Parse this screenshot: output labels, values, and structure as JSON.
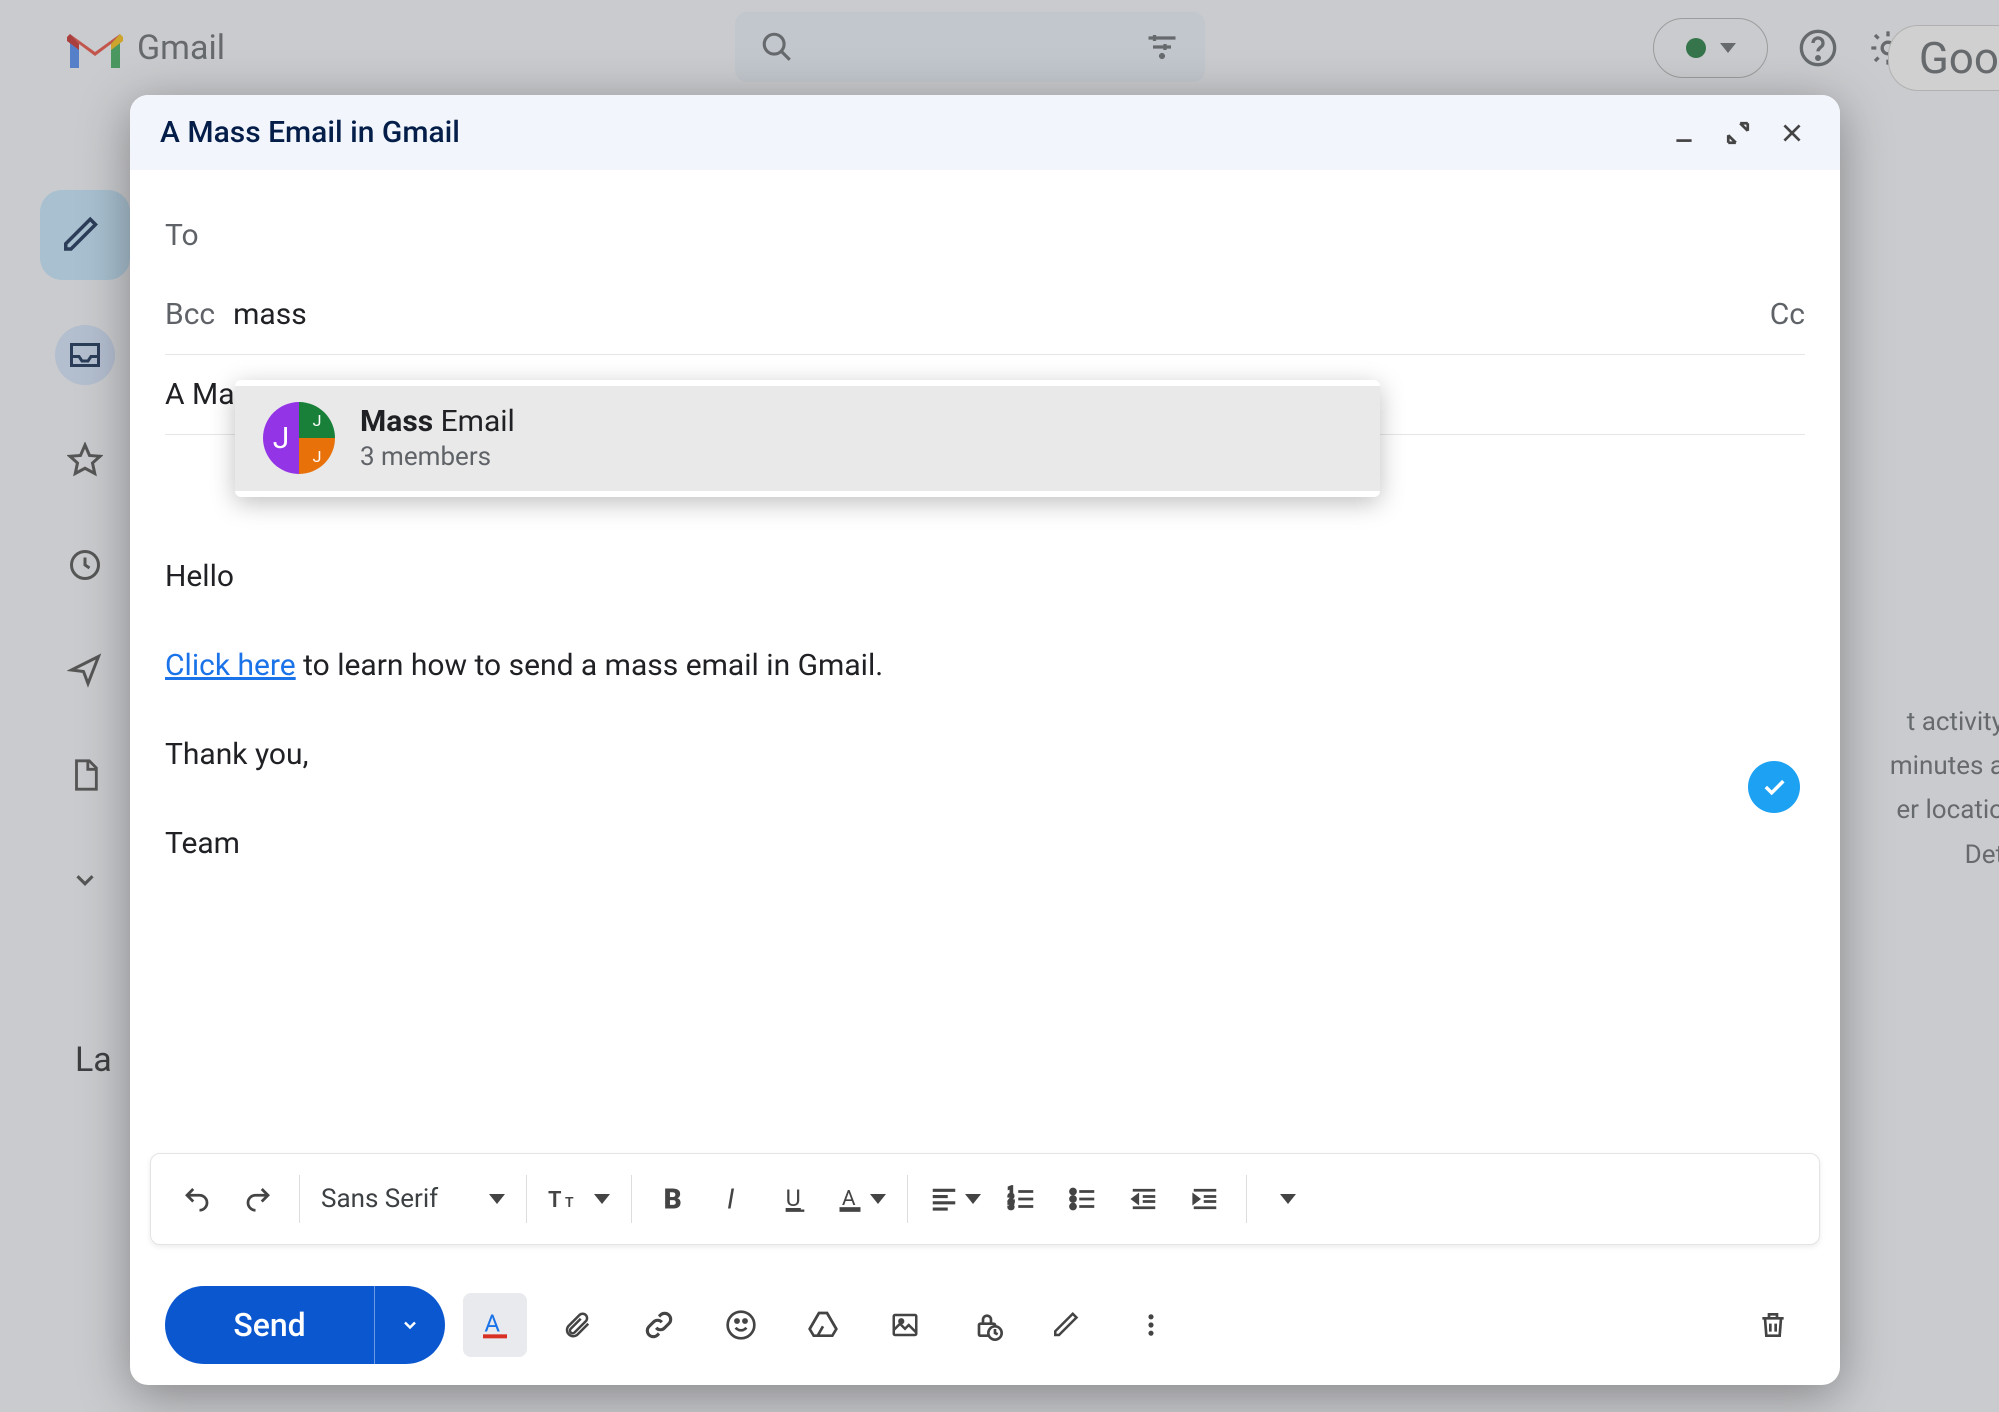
{
  "app": {
    "name": "Gmail",
    "google_partial": "Goo"
  },
  "background": {
    "labels_title": "La",
    "right_info": [
      "t activity",
      "minutes a",
      "er locatio",
      "Det"
    ]
  },
  "compose": {
    "title": "A Mass Email in Gmail",
    "to_label": "To",
    "bcc_label": "Bcc",
    "bcc_value": "mass",
    "cc_label": "Cc",
    "subject": "A Ma",
    "body_hello": "Hello",
    "body_link": "Click here",
    "body_link_rest": " to learn how to send a mass email in Gmail.",
    "body_thanks": "Thank you,",
    "body_sign": "Team",
    "suggestion": {
      "bold": "Mass",
      "rest": " Email",
      "sub": "3 members",
      "avatar_letter": "J"
    },
    "font_name": "Sans Serif",
    "send_label": "Send"
  }
}
